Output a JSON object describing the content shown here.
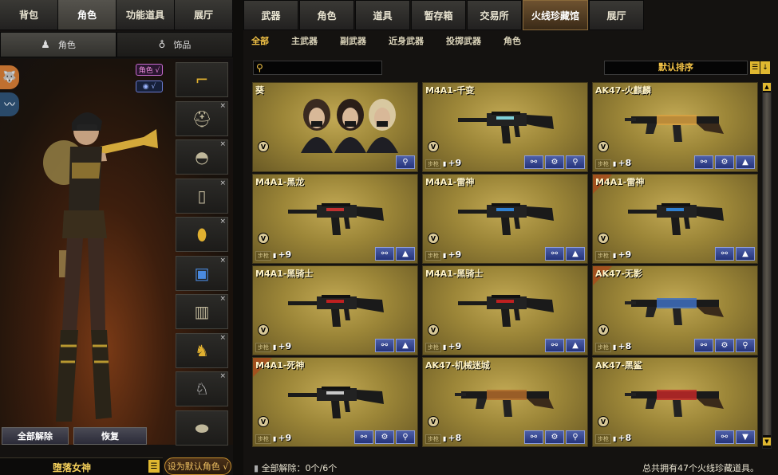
{
  "left_tabs": [
    "背包",
    "角色",
    "功能道具",
    "展厅"
  ],
  "left_active_tab": 1,
  "sub_tabs": [
    "角色",
    "饰品"
  ],
  "role_chip": "角色 √",
  "eye_chip": "√",
  "slot_icons": [
    "golden-gun-icon",
    "helmet-icon",
    "goggles-icon",
    "radio-icon",
    "golden-grenade-icon",
    "blue-armor-icon",
    "ammo-belt-icon",
    "gold-horse-icon",
    "silver-horse-icon",
    "shield-icon"
  ],
  "buttons": {
    "release_all": "全部解除",
    "restore": "恢复",
    "set_default": "设为默认角色 √"
  },
  "character_name": "堕落女神",
  "right_tabs": [
    "武器",
    "角色",
    "道具",
    "暂存箱",
    "交易所",
    "火线珍藏馆",
    "展厅"
  ],
  "right_active_tab": 5,
  "filters": [
    "全部",
    "主武器",
    "副武器",
    "近身武器",
    "投掷武器",
    "角色"
  ],
  "filter_active": 0,
  "search": {
    "placeholder": ""
  },
  "sort_label": "默认排序",
  "items": [
    {
      "title": "葵",
      "type": "",
      "level": "",
      "kind": "characters",
      "buttons": [
        "search"
      ]
    },
    {
      "title": "M4A1-千变",
      "type": "步枪",
      "level": "+9",
      "kind": "rifle",
      "color": "#7fd0d8",
      "buttons": [
        "skin",
        "gear",
        "search"
      ]
    },
    {
      "title": "AK47-火麒麟",
      "type": "步枪",
      "level": "+8",
      "kind": "ak",
      "color": "#d8a040",
      "buttons": [
        "skin",
        "gear",
        "up"
      ]
    },
    {
      "title": "M4A1-黑龙",
      "type": "步枪",
      "level": "+9",
      "kind": "rifle",
      "color": "#c03030",
      "buttons": [
        "skin",
        "up"
      ]
    },
    {
      "title": "M4A1-雷神",
      "type": "步枪",
      "level": "+9",
      "kind": "rifle",
      "color": "#3080d0",
      "buttons": [
        "skin",
        "up"
      ]
    },
    {
      "title": "M4A1-雷神",
      "type": "步枪",
      "level": "+9",
      "kind": "rifle",
      "color": "#3080d0",
      "buttons": [
        "skin",
        "up"
      ],
      "flag": true
    },
    {
      "title": "M4A1-黑骑士",
      "type": "步枪",
      "level": "+9",
      "kind": "rifle",
      "color": "#c02020",
      "buttons": [
        "skin",
        "up"
      ]
    },
    {
      "title": "M4A1-黑骑士",
      "type": "步枪",
      "level": "+9",
      "kind": "rifle",
      "color": "#c02020",
      "buttons": [
        "skin",
        "up"
      ]
    },
    {
      "title": "AK47-无影",
      "type": "步枪",
      "level": "+8",
      "kind": "ak",
      "color": "#4070c0",
      "buttons": [
        "skin",
        "gear",
        "search"
      ],
      "flag": true
    },
    {
      "title": "M4A1-死神",
      "type": "步枪",
      "level": "+9",
      "kind": "rifle",
      "color": "#c8c8c8",
      "buttons": [
        "skin",
        "gear",
        "search"
      ],
      "flag": true
    },
    {
      "title": "AK47-机械迷城",
      "type": "步枪",
      "level": "+8",
      "kind": "ak",
      "color": "#b06a2a",
      "buttons": [
        "skin",
        "gear",
        "search"
      ]
    },
    {
      "title": "AK47-黑鲨",
      "type": "步枪",
      "level": "+8",
      "kind": "ak",
      "color": "#c02828",
      "buttons": [
        "skin",
        "down"
      ]
    }
  ],
  "footer": {
    "left": "全部解除：0个/6个",
    "right": "总共拥有47个火线珍藏道具。"
  }
}
